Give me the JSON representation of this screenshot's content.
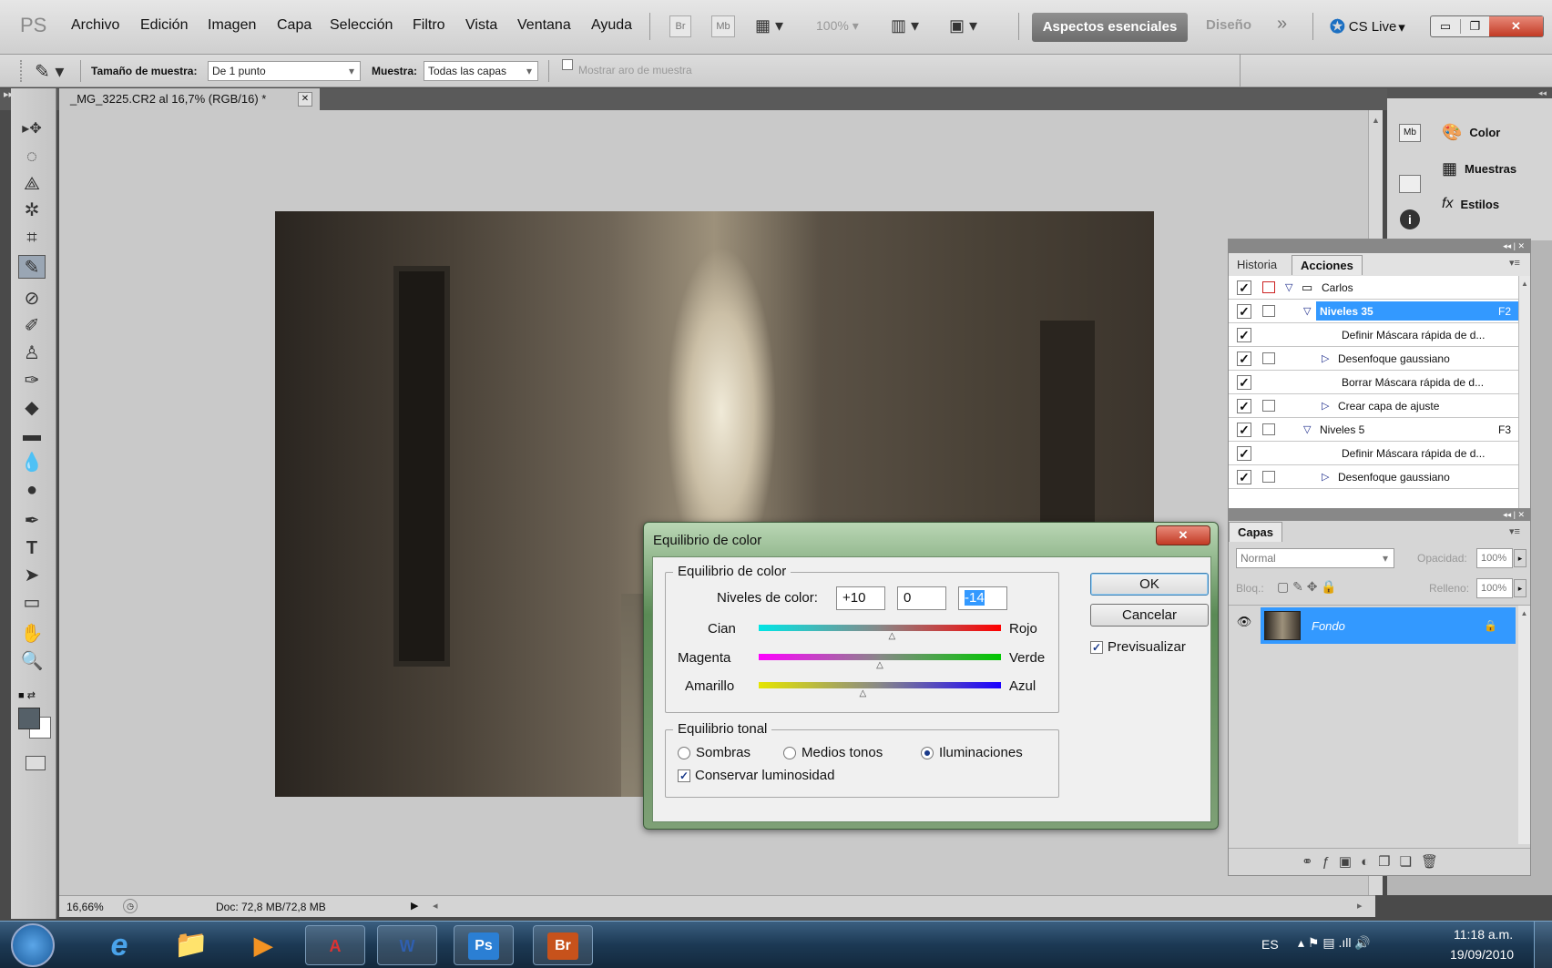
{
  "menubar": {
    "logo": "PS",
    "items": [
      "Archivo",
      "Edición",
      "Imagen",
      "Capa",
      "Selección",
      "Filtro",
      "Vista",
      "Ventana",
      "Ayuda"
    ],
    "br": "Br",
    "mb": "Mb",
    "zoom": "100%",
    "workspace_active": "Aspectos esenciales",
    "workspace_other": "Diseño",
    "more": "»",
    "cslive": "CS Live"
  },
  "options": {
    "sample_size_label": "Tamaño de muestra:",
    "sample_size_value": "De 1 punto",
    "sample_label": "Muestra:",
    "sample_value": "Todas las capas",
    "show_ring_label": "Mostrar aro de muestra"
  },
  "document": {
    "tab_title": "_MG_3225.CR2 al 16,7% (RGB/16) *",
    "tab_close": "✕"
  },
  "dock": {
    "color": "Color",
    "swatches": "Muestras",
    "styles": "Estilos"
  },
  "actions_panel": {
    "tab_history": "Historia",
    "tab_actions": "Acciones",
    "rows": [
      {
        "label": "Carlos",
        "shortcut": "",
        "indent": 0,
        "type": "folder",
        "dialog": true,
        "red": true
      },
      {
        "label": "Niveles 35",
        "shortcut": "F2",
        "indent": 1,
        "type": "open",
        "dialog": true,
        "selected": true
      },
      {
        "label": "Definir Máscara rápida de d...",
        "shortcut": "",
        "indent": 2,
        "type": "item",
        "dialog": false
      },
      {
        "label": "Desenfoque gaussiano",
        "shortcut": "",
        "indent": 2,
        "type": "closed",
        "dialog": true
      },
      {
        "label": "Borrar Máscara rápida de d...",
        "shortcut": "",
        "indent": 2,
        "type": "item",
        "dialog": false
      },
      {
        "label": "Crear capa de ajuste",
        "shortcut": "",
        "indent": 2,
        "type": "closed",
        "dialog": true
      },
      {
        "label": "Niveles 5",
        "shortcut": "F3",
        "indent": 1,
        "type": "open",
        "dialog": true
      },
      {
        "label": "Definir Máscara rápida de d...",
        "shortcut": "",
        "indent": 2,
        "type": "item",
        "dialog": false
      },
      {
        "label": "Desenfoque gaussiano",
        "shortcut": "",
        "indent": 2,
        "type": "closed",
        "dialog": true
      }
    ]
  },
  "layers_panel": {
    "tab": "Capas",
    "blend_mode": "Normal",
    "opacity_label": "Opacidad:",
    "opacity_value": "100%",
    "lock_label": "Bloq.:",
    "fill_label": "Relleno:",
    "fill_value": "100%",
    "layer_name": "Fondo"
  },
  "status": {
    "zoom": "16,66%",
    "doc": "Doc: 72,8 MB/72,8 MB"
  },
  "dialog": {
    "title": "Equilibrio de color",
    "group1": "Equilibrio de color",
    "levels_label": "Niveles de color:",
    "level1": "+10",
    "level2": "0",
    "level3": "-14",
    "cyan": "Cian",
    "red": "Rojo",
    "magenta": "Magenta",
    "green": "Verde",
    "yellow": "Amarillo",
    "blue": "Azul",
    "slider_values": [
      10,
      0,
      -14
    ],
    "group2": "Equilibrio tonal",
    "shadows": "Sombras",
    "midtones": "Medios tonos",
    "highlights": "Iluminaciones",
    "tone_selected": "Iluminaciones",
    "preserve": "Conservar luminosidad",
    "preserve_checked": true,
    "ok": "OK",
    "cancel": "Cancelar",
    "preview": "Previsualizar",
    "preview_checked": true
  },
  "taskbar": {
    "lang": "ES",
    "time": "11:18 a.m.",
    "date": "19/09/2010",
    "ps": "Ps",
    "br": "Br"
  },
  "colors": {
    "selection_blue": "#3399ff",
    "photoshop_blue": "#2b7fd4",
    "bridge_orange": "#c7521b"
  }
}
